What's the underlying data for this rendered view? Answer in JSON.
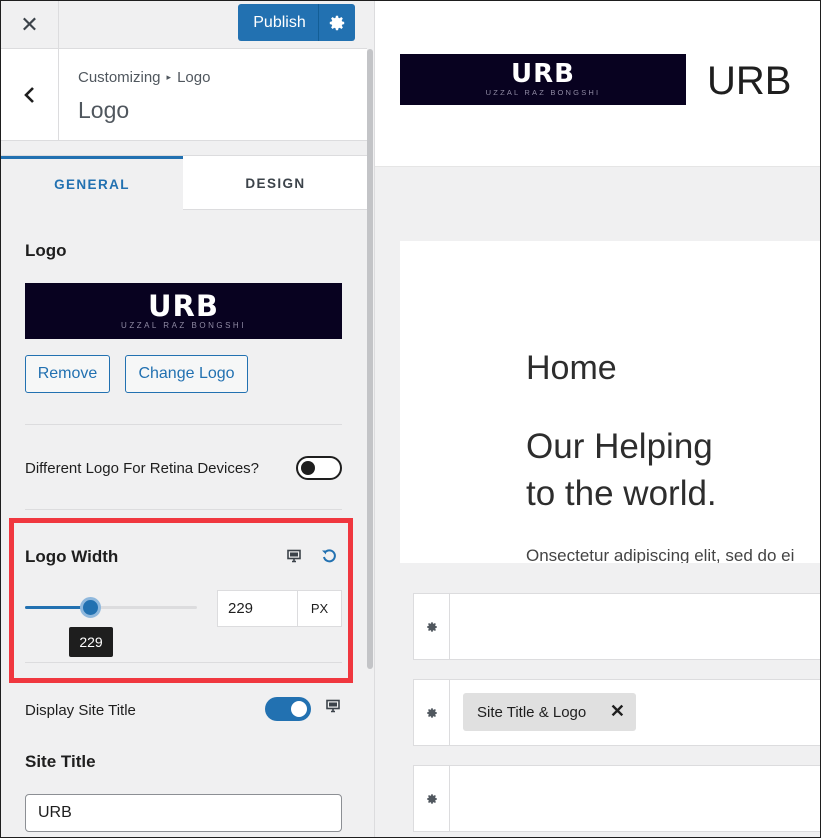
{
  "topbar": {
    "close_glyph": "✕",
    "publish_label": "Publish",
    "settings_icon": "gear-icon"
  },
  "header": {
    "back_glyph": "‹",
    "breadcrumb_root": "Customizing",
    "breadcrumb_sep": "▸",
    "breadcrumb_leaf": "Logo",
    "title": "Logo"
  },
  "tabs": [
    {
      "label": "GENERAL",
      "active": true
    },
    {
      "label": "DESIGN",
      "active": false
    }
  ],
  "logo_section": {
    "title": "Logo",
    "logo_text": "URB",
    "logo_subtext": "UZZAL RAZ BONGSHI",
    "remove_label": "Remove",
    "change_label": "Change Logo"
  },
  "retina": {
    "label": "Different Logo For Retina Devices?",
    "enabled": false
  },
  "logo_width": {
    "title": "Logo Width",
    "value": "229",
    "unit": "PX",
    "tooltip": "229",
    "slider_fraction": 0.38
  },
  "display_site_title": {
    "label": "Display Site Title",
    "enabled": true
  },
  "site_title": {
    "title": "Site Title",
    "value": "URB"
  },
  "preview": {
    "site_title": "URB",
    "logo_text": "URB",
    "logo_subtext": "UZZAL RAZ BONGSHI",
    "home": "Home",
    "heading_line1": "Our Helping",
    "heading_line2": "to the world.",
    "paragraph": "Onsectetur adipiscing elit, sed do ei",
    "chip_label": "Site Title & Logo",
    "chip_close": "✕"
  },
  "colors": {
    "accent": "#2271b1",
    "highlight": "#f0373f",
    "logo_bg": "#080220"
  }
}
